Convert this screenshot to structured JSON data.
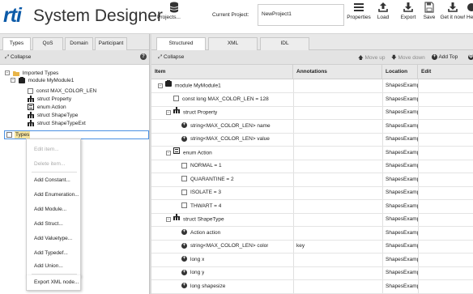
{
  "header": {
    "logo": "rti",
    "title": "System Designer",
    "projects_label": "Projects...",
    "current_project_label": "Current Project:",
    "current_project_value": "NewProject1",
    "toolbar": [
      {
        "label": "Properties",
        "icon": "properties-icon"
      },
      {
        "label": "Load",
        "icon": "upload-icon"
      },
      {
        "label": "Export",
        "icon": "download-icon"
      },
      {
        "label": "Save",
        "icon": "save-icon"
      },
      {
        "label": "Get it now!",
        "icon": "download-icon"
      },
      {
        "label": "He",
        "icon": "help-icon"
      }
    ]
  },
  "left_tabs": [
    "Types",
    "QoS",
    "Domain",
    "Participant"
  ],
  "left_active_tab": "Types",
  "right_tabs": [
    "Structured",
    "XML",
    "IDL"
  ],
  "right_active_tab": "Structured",
  "left_toolbar": {
    "collapse": "Collapse",
    "help": "?"
  },
  "tree": {
    "imported_types": "Imported Types",
    "module": "module MyModule1",
    "children": [
      {
        "label": "const MAX_COLOR_LEN",
        "icon": "const-icon"
      },
      {
        "label": "struct Property",
        "icon": "struct-icon"
      },
      {
        "label": "enum Action",
        "icon": "enum-icon"
      },
      {
        "label": "struct ShapeType",
        "icon": "struct-icon"
      },
      {
        "label": "struct ShapeTypeExt",
        "icon": "struct-icon"
      }
    ],
    "types_input": "Types"
  },
  "context_menu": {
    "items": [
      {
        "label": "Edit item...",
        "enabled": false
      },
      {
        "label": "Delete item...",
        "enabled": false
      },
      {
        "label": "Add Constant...",
        "enabled": true
      },
      {
        "label": "Add Enumeration...",
        "enabled": true
      },
      {
        "label": "Add Module...",
        "enabled": true
      },
      {
        "label": "Add Struct...",
        "enabled": true
      },
      {
        "label": "Add Valuetype...",
        "enabled": true
      },
      {
        "label": "Add Typedef...",
        "enabled": true
      },
      {
        "label": "Add Union...",
        "enabled": true
      },
      {
        "label": "Export XML node...",
        "enabled": true
      }
    ]
  },
  "right_toolbar": {
    "collapse": "Collapse",
    "move_up": "Move up",
    "move_down": "Move down",
    "add_top": "Add Top"
  },
  "grid": {
    "columns": [
      "Item",
      "Annotations",
      "Location",
      "Edit"
    ],
    "rows": [
      {
        "label": "module MyModule1",
        "indent": 0,
        "icon": "module",
        "expander": true,
        "annotation": "",
        "location": "ShapesExample.xr"
      },
      {
        "label": "const long MAX_COLOR_LEN = 128",
        "indent": 1,
        "icon": "box",
        "expander": false,
        "annotation": "",
        "location": "ShapesExample.xr"
      },
      {
        "label": "struct Property",
        "indent": 1,
        "icon": "struct",
        "expander": true,
        "annotation": "",
        "location": "ShapesExample.xr"
      },
      {
        "label": "string<MAX_COLOR_LEN> name",
        "indent": 2,
        "icon": "plus",
        "expander": false,
        "annotation": "",
        "location": "ShapesExample.xr"
      },
      {
        "label": "string<MAX_COLOR_LEN> value",
        "indent": 2,
        "icon": "plus",
        "expander": false,
        "annotation": "",
        "location": "ShapesExample.xr"
      },
      {
        "label": "enum Action",
        "indent": 1,
        "icon": "enum",
        "expander": true,
        "annotation": "",
        "location": "ShapesExample.xr"
      },
      {
        "label": "NORMAL = 1",
        "indent": 2,
        "icon": "box",
        "expander": false,
        "annotation": "",
        "location": "ShapesExample.xr"
      },
      {
        "label": "QUARANTINE = 2",
        "indent": 2,
        "icon": "box",
        "expander": false,
        "annotation": "",
        "location": "ShapesExample.xr"
      },
      {
        "label": "ISOLATE = 3",
        "indent": 2,
        "icon": "box",
        "expander": false,
        "annotation": "",
        "location": "ShapesExample.xr"
      },
      {
        "label": "THWART = 4",
        "indent": 2,
        "icon": "box",
        "expander": false,
        "annotation": "",
        "location": "ShapesExample.xr"
      },
      {
        "label": "struct ShapeType",
        "indent": 1,
        "icon": "struct",
        "expander": true,
        "annotation": "",
        "location": "ShapesExample.xr"
      },
      {
        "label": "Action action",
        "indent": 2,
        "icon": "plus",
        "expander": false,
        "annotation": "",
        "location": "ShapesExample.xr"
      },
      {
        "label": "string<MAX_COLOR_LEN> color",
        "indent": 2,
        "icon": "plus",
        "expander": false,
        "annotation": "key",
        "location": "ShapesExample.xr"
      },
      {
        "label": "long x",
        "indent": 2,
        "icon": "plus",
        "expander": false,
        "annotation": "",
        "location": "ShapesExample.xr"
      },
      {
        "label": "long y",
        "indent": 2,
        "icon": "plus",
        "expander": false,
        "annotation": "",
        "location": "ShapesExample.xr"
      },
      {
        "label": "long shapesize",
        "indent": 2,
        "icon": "plus",
        "expander": false,
        "annotation": "",
        "location": "ShapesExample.xr"
      }
    ]
  },
  "colors": {
    "brand": "#0b5aa8",
    "selection_highlight": "#f7e59e",
    "focus_border": "#4a90e2"
  }
}
